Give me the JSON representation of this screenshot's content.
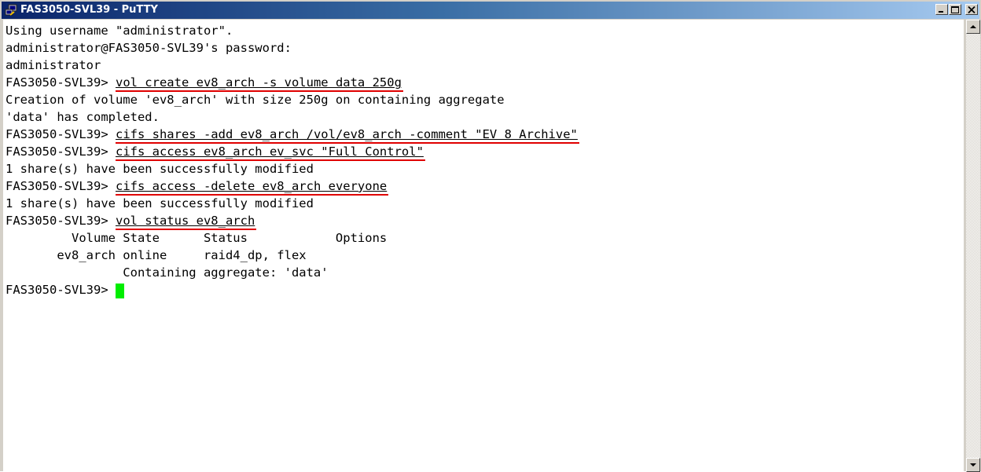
{
  "window": {
    "title": "FAS3050-SVL39 - PuTTY",
    "icon": "putty-icon",
    "controls": [
      "minimize-icon",
      "maximize-icon",
      "close-icon"
    ]
  },
  "terminal": {
    "background": "#ffffff",
    "foreground": "#000000",
    "cursor_color": "#00ee00",
    "highlight_color": "#e00000",
    "prompt": "FAS3050-SVL39> ",
    "lines": [
      {
        "text": "Using username \"administrator\"."
      },
      {
        "text": "administrator@FAS3050-SVL39's password:"
      },
      {
        "text": "administrator"
      },
      {
        "prompt": "FAS3050-SVL39> ",
        "cmd": "vol create ev8_arch -s volume data 250g"
      },
      {
        "text": "Creation of volume 'ev8_arch' with size 250g on containing aggregate"
      },
      {
        "text": "'data' has completed."
      },
      {
        "prompt": "FAS3050-SVL39> ",
        "cmd": "cifs shares -add ev8_arch /vol/ev8_arch -comment \"EV 8 Archive\""
      },
      {
        "prompt": "FAS3050-SVL39> ",
        "cmd": "cifs access ev8_arch ev_svc \"Full Control\""
      },
      {
        "text": "1 share(s) have been successfully modified"
      },
      {
        "prompt": "FAS3050-SVL39> ",
        "cmd": "cifs access -delete ev8_arch everyone"
      },
      {
        "text": "1 share(s) have been successfully modified"
      },
      {
        "prompt": "FAS3050-SVL39> ",
        "cmd": "vol status ev8_arch"
      },
      {
        "text": "         Volume State      Status            Options"
      },
      {
        "text": "       ev8_arch online     raid4_dp, flex"
      },
      {
        "text": "                Containing aggregate: 'data'"
      },
      {
        "prompt": "FAS3050-SVL39> ",
        "cmd": "",
        "cursor": true
      }
    ]
  },
  "scrollbar": {
    "up": "scroll-up-arrow-icon",
    "down": "scroll-down-arrow-icon"
  }
}
